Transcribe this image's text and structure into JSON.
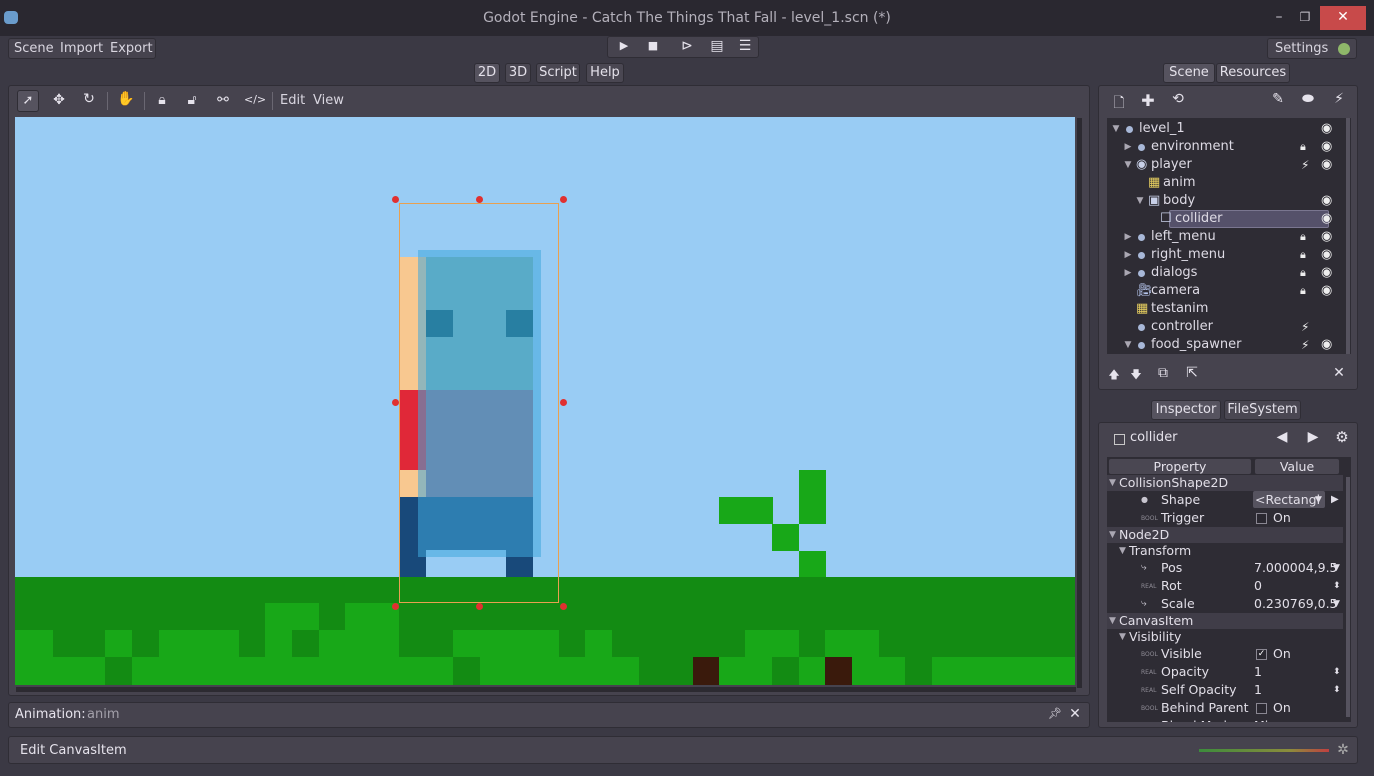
{
  "window": {
    "title": "Godot Engine - Catch The Things That Fall - level_1.scn (*)",
    "min": "–",
    "max": "❐",
    "close": "✕"
  },
  "menu": {
    "scene": "Scene",
    "import": "Import",
    "export": "Export"
  },
  "play": {
    "play": "▶",
    "stop": "■",
    "play_scene": "⊳",
    "play_custom": "▤",
    "debug": "☰"
  },
  "settings": {
    "label": "Settings"
  },
  "main_tabs": [
    "2D",
    "3D",
    "Script",
    "Help"
  ],
  "editor_toolbar": {
    "edit": "Edit",
    "view": "View"
  },
  "dock_tabs": {
    "scene": "Scene",
    "resources": "Resources",
    "inspector": "Inspector",
    "filesystem": "FileSystem"
  },
  "scene_tree": [
    {
      "name": "level_1",
      "depth": 0,
      "arrow": "▼",
      "icon": "node-dot",
      "eye": true
    },
    {
      "name": "environment",
      "depth": 1,
      "arrow": "▶",
      "icon": "node-dot",
      "lock": true,
      "eye": true
    },
    {
      "name": "player",
      "depth": 1,
      "arrow": "▼",
      "icon": "kinematic",
      "script": true,
      "eye": true
    },
    {
      "name": "anim",
      "depth": 2,
      "arrow": "",
      "icon": "animation",
      "eye": false
    },
    {
      "name": "body",
      "depth": 2,
      "arrow": "▼",
      "icon": "sprite",
      "eye": true
    },
    {
      "name": "collider",
      "depth": 3,
      "arrow": "",
      "icon": "collision-shape",
      "eye": true,
      "selected": true
    },
    {
      "name": "left_menu",
      "depth": 1,
      "arrow": "▶",
      "icon": "node-dot",
      "lock": true,
      "eye": true
    },
    {
      "name": "right_menu",
      "depth": 1,
      "arrow": "▶",
      "icon": "node-dot",
      "lock": true,
      "eye": true
    },
    {
      "name": "dialogs",
      "depth": 1,
      "arrow": "▶",
      "icon": "node-dot",
      "lock": true,
      "eye": true
    },
    {
      "name": "camera",
      "depth": 1,
      "arrow": "",
      "icon": "camera",
      "lock": true,
      "eye": true
    },
    {
      "name": "testanim",
      "depth": 1,
      "arrow": "",
      "icon": "animation",
      "eye": false
    },
    {
      "name": "controller",
      "depth": 1,
      "arrow": "",
      "icon": "node-dot",
      "script": true,
      "eye": false
    },
    {
      "name": "food_spawner",
      "depth": 1,
      "arrow": "▼",
      "icon": "node-dot",
      "script": true,
      "eye": true
    }
  ],
  "inspector": {
    "node_name": "collider",
    "header_property": "Property",
    "header_value": "Value",
    "rows": [
      {
        "kind": "section",
        "label": "CollisionShape2D",
        "depth": 0
      },
      {
        "kind": "prop",
        "label": "Shape",
        "value": "<Rectangl",
        "tag": "obj",
        "control": "dropdown"
      },
      {
        "kind": "prop",
        "label": "Trigger",
        "value": "On",
        "tag": "BOOL",
        "control": "check",
        "checked": false
      },
      {
        "kind": "section",
        "label": "Node2D",
        "depth": 0
      },
      {
        "kind": "section",
        "label": "Transform",
        "depth": 1
      },
      {
        "kind": "prop",
        "label": "Pos",
        "value": "7.000004,9.5",
        "tag": "vec",
        "control": "arrow"
      },
      {
        "kind": "prop",
        "label": "Rot",
        "value": "0",
        "tag": "REAL",
        "control": "spin"
      },
      {
        "kind": "prop",
        "label": "Scale",
        "value": "0.230769,0.5",
        "tag": "vec",
        "control": "arrow"
      },
      {
        "kind": "section",
        "label": "CanvasItem",
        "depth": 0
      },
      {
        "kind": "section",
        "label": "Visibility",
        "depth": 1
      },
      {
        "kind": "prop",
        "label": "Visible",
        "value": "On",
        "tag": "BOOL",
        "control": "check",
        "checked": true
      },
      {
        "kind": "prop",
        "label": "Opacity",
        "value": "1",
        "tag": "REAL",
        "control": "spin"
      },
      {
        "kind": "prop",
        "label": "Self Opacity",
        "value": "1",
        "tag": "REAL",
        "control": "spin"
      },
      {
        "kind": "prop",
        "label": "Behind Parent",
        "value": "On",
        "tag": "BOOL",
        "control": "check",
        "checked": false
      },
      {
        "kind": "prop",
        "label": "Blend Mode",
        "value": "Mix",
        "tag": "enum",
        "control": "arrow"
      }
    ]
  },
  "animation_panel": {
    "label": "Animation:",
    "value": "anim"
  },
  "status": {
    "text": "Edit CanvasItem"
  },
  "colors": {
    "sky": "#99ccf4",
    "grass_dark": "#138b13",
    "grass_light": "#18a818",
    "selection": "#e8a050",
    "handle": "#e03030"
  }
}
